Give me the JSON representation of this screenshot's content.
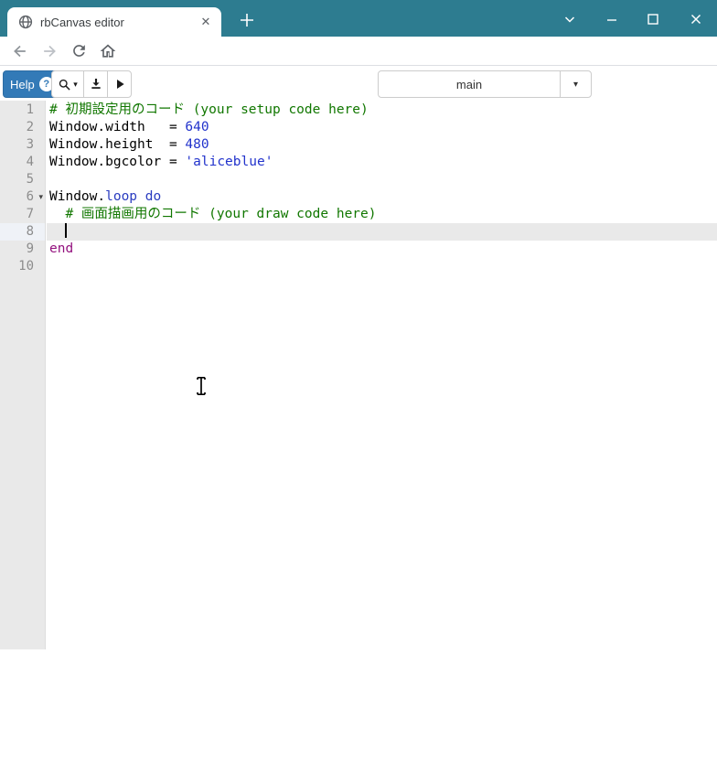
{
  "browser": {
    "tab_title": "rbCanvas editor",
    "url": "rbcanvas.net/editor/0.8.0/rbcanvas_editor.html",
    "frame_color": "#2d7c90"
  },
  "toolbar": {
    "help_label": "Help",
    "help_badge": "?",
    "help_color": "#337ab7",
    "file_select": {
      "value": "main"
    }
  },
  "icons": {
    "tab_close": "✕",
    "new_tab": "+",
    "search_caret": "▾",
    "file_caret": "▾",
    "fold_arrow": "▾"
  },
  "editor": {
    "active_line": 8,
    "folded_line": 6,
    "colors": {
      "comment": "#117700",
      "number": "#2233cc",
      "string": "#2233cc",
      "keyword": "#93117e",
      "keyword_blue": "#2a3cc0",
      "gutter_bg": "#e9e9e9",
      "active_line_bg": "#e9e9e9"
    },
    "lines": [
      {
        "num": "1",
        "tokens": [
          {
            "text": "# 初期設定用のコード (your setup code here)",
            "type": "comment"
          }
        ]
      },
      {
        "num": "2",
        "tokens": [
          {
            "text": "Window.width   = ",
            "type": "plain"
          },
          {
            "text": "640",
            "type": "number"
          }
        ]
      },
      {
        "num": "3",
        "tokens": [
          {
            "text": "Window.height  = ",
            "type": "plain"
          },
          {
            "text": "480",
            "type": "number"
          }
        ]
      },
      {
        "num": "4",
        "tokens": [
          {
            "text": "Window.bgcolor = ",
            "type": "plain"
          },
          {
            "text": "'aliceblue'",
            "type": "string"
          }
        ]
      },
      {
        "num": "5",
        "tokens": []
      },
      {
        "num": "6",
        "tokens": [
          {
            "text": "Window.",
            "type": "plain"
          },
          {
            "text": "loop",
            "type": "kw-blue"
          },
          {
            "text": " ",
            "type": "plain"
          },
          {
            "text": "do",
            "type": "kw-blue"
          }
        ],
        "fold": true
      },
      {
        "num": "7",
        "tokens": [
          {
            "text": "  ",
            "type": "plain"
          },
          {
            "text": "# 画面描画用のコード (your draw code here)",
            "type": "comment"
          }
        ]
      },
      {
        "num": "8",
        "tokens": [
          {
            "text": "  ",
            "type": "plain"
          }
        ],
        "cursor": true
      },
      {
        "num": "9",
        "tokens": [
          {
            "text": "end",
            "type": "keyword"
          }
        ]
      },
      {
        "num": "10",
        "tokens": []
      }
    ]
  }
}
